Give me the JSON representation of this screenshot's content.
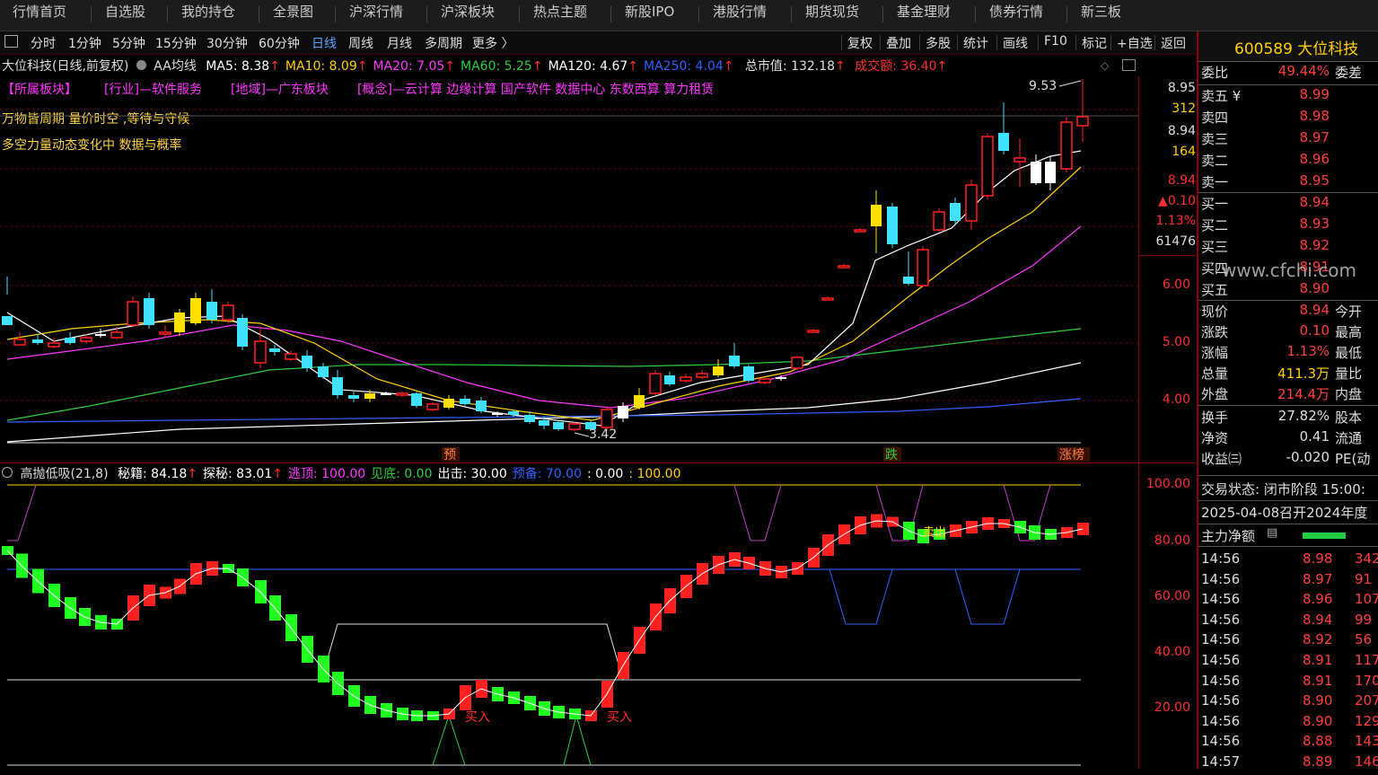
{
  "nav": [
    "行情首页",
    "自选股",
    "我的持仓",
    "全景图",
    "沪深行情",
    "沪深板块",
    "热点主题",
    "新股IPO",
    "港股行情",
    "期货现货",
    "基金理财",
    "债券行情",
    "新三板"
  ],
  "periods": [
    "分时",
    "1分钟",
    "5分钟",
    "15分钟",
    "30分钟",
    "60分钟",
    "日线",
    "周线",
    "月线",
    "多周期",
    "更多 〉"
  ],
  "active_period": "日线",
  "tools": [
    "复权",
    "叠加",
    "多股",
    "统计",
    "画线",
    "F10",
    "标记",
    "+自选",
    "返回"
  ],
  "stock": {
    "code": "600589",
    "name": "大位科技",
    "header": "600589 大位科技"
  },
  "chart_title": "大位科技(日线,前复权)",
  "indicator_name": "AA均线",
  "ma": [
    {
      "label": "MA5: 8.38",
      "color": "#ffffff"
    },
    {
      "label": "MA10: 8.09",
      "color": "#ffd000"
    },
    {
      "label": "MA20: 7.05",
      "color": "#ff37ff"
    },
    {
      "label": "MA60: 5.25",
      "color": "#2ecc40"
    },
    {
      "label": "MA120: 4.67",
      "color": "#ffffff"
    },
    {
      "label": "MA250: 4.04",
      "color": "#3060ff"
    }
  ],
  "mktcap": "总市值: 132.18",
  "volume_amt": "成交额: 36.40",
  "boards": [
    "【所属板块】",
    "[行业]—软件服务",
    "[地域]—广东板块",
    "[概念]—云计算 边缘计算 国产软件 数据中心 东数西算 算力租赁"
  ],
  "note1": "万物皆周期  量价时空 ,等待与守候",
  "note2": "多空力量动态变化中 数据与概率",
  "high_label": "9.53",
  "low_label": "3.42",
  "event_labels": [
    "预",
    "跌",
    "涨榜"
  ],
  "price_scale": [
    "6.00",
    "5.00",
    "4.00"
  ],
  "quote_mini": [
    "8.95",
    "312",
    "8.94",
    "164",
    "8.94",
    "▲0.10",
    "1.13%",
    "61476"
  ],
  "sub_indicator": {
    "name": "高抛低吸(21,8)",
    "items": [
      {
        "t": "秘籍: 84.18",
        "c": "#ffffff"
      },
      {
        "t": "探秘: 83.01",
        "c": "#ffffff"
      },
      {
        "t": "逃顶: 100.00",
        "c": "#ff37ff"
      },
      {
        "t": "见底: 0.00",
        "c": "#2ecc40"
      },
      {
        "t": "出击: 30.00",
        "c": "#ffffff"
      },
      {
        "t": "预备: 70.00",
        "c": "#3060ff"
      },
      {
        "t": ": 0.00",
        "c": "#ffffff"
      },
      {
        "t": ": 100.00",
        "c": "#ffd000"
      }
    ],
    "scale": [
      "100.00",
      "80.00",
      "60.00",
      "40.00",
      "20.00"
    ],
    "buy_label": "买入",
    "sell_label": "卖出"
  },
  "order_book": {
    "weibi_label": "委比",
    "weibi": "49.44%",
    "weicha_label": "委差",
    "asks": [
      {
        "l": "卖五 ¥",
        "p": "8.99"
      },
      {
        "l": "卖四",
        "p": "8.98"
      },
      {
        "l": "卖三",
        "p": "8.97"
      },
      {
        "l": "卖二",
        "p": "8.96"
      },
      {
        "l": "卖一",
        "p": "8.95"
      }
    ],
    "bids": [
      {
        "l": "买一",
        "p": "8.94"
      },
      {
        "l": "买二",
        "p": "8.93"
      },
      {
        "l": "买三",
        "p": "8.92"
      },
      {
        "l": "买四",
        "p": "8.91"
      },
      {
        "l": "买五",
        "p": "8.90"
      }
    ]
  },
  "watermark": "www.cfchi.com",
  "stats": [
    {
      "l": "现价",
      "v": "8.94",
      "c": "red",
      "r": "今开"
    },
    {
      "l": "涨跌",
      "v": "0.10",
      "c": "red",
      "r": "最高"
    },
    {
      "l": "涨幅",
      "v": "1.13%",
      "c": "red",
      "r": "最低"
    },
    {
      "l": "总量",
      "v": "411.3万",
      "c": "ylw",
      "r": "量比"
    },
    {
      "l": "外盘",
      "v": "214.4万",
      "c": "red",
      "r": "内盘"
    },
    {
      "l": "换手",
      "v": "27.82%",
      "c": "wht",
      "r": "股本"
    },
    {
      "l": "净资",
      "v": "0.41",
      "c": "wht",
      "r": "流通"
    },
    {
      "l": "收益㈢",
      "v": "-0.020",
      "c": "wht",
      "r": "PE(动"
    }
  ],
  "trade_status": "交易状态: 闭市阶段 15:00:",
  "announcement": "2025-04-08召开2024年度",
  "main_net": "主力净额",
  "ticks": [
    {
      "t": "14:56",
      "p": "8.98",
      "v": "342"
    },
    {
      "t": "14:56",
      "p": "8.97",
      "v": "91"
    },
    {
      "t": "14:56",
      "p": "8.96",
      "v": "107"
    },
    {
      "t": "14:56",
      "p": "8.94",
      "v": "99"
    },
    {
      "t": "14:56",
      "p": "8.92",
      "v": "56"
    },
    {
      "t": "14:56",
      "p": "8.91",
      "v": "117"
    },
    {
      "t": "14:56",
      "p": "8.91",
      "v": "170"
    },
    {
      "t": "14:56",
      "p": "8.90",
      "v": "207"
    },
    {
      "t": "14:56",
      "p": "8.90",
      "v": "129"
    },
    {
      "t": "14:56",
      "p": "8.88",
      "v": "143"
    },
    {
      "t": "14:57",
      "p": "8.89",
      "v": "146"
    }
  ]
}
